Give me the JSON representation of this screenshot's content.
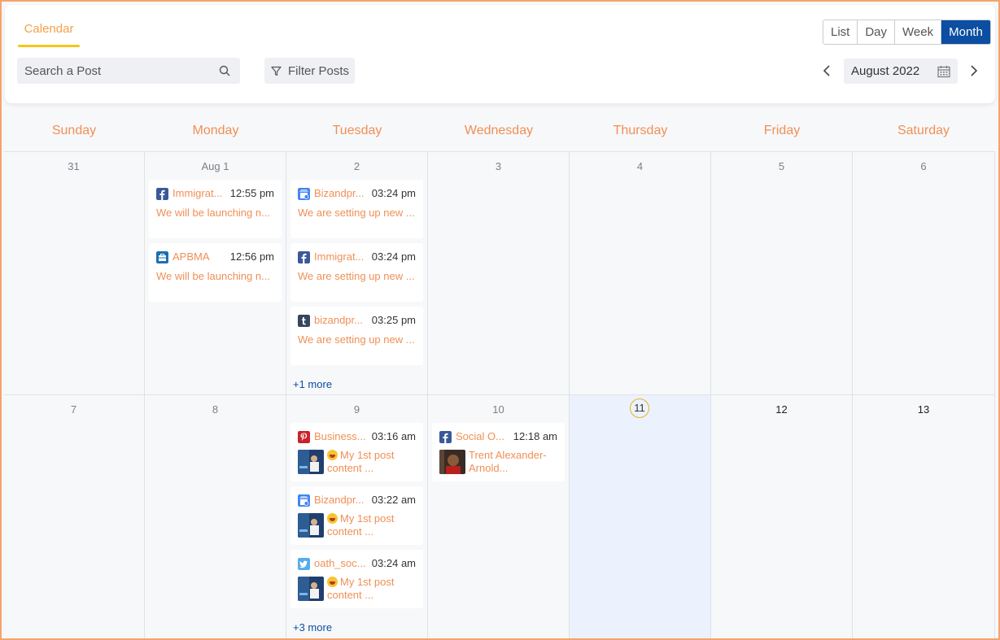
{
  "header": {
    "tab_label": "Calendar",
    "search_placeholder": "Search a Post",
    "filter_label": "Filter Posts",
    "views": [
      "List",
      "Day",
      "Week",
      "Month"
    ],
    "active_view": "Month",
    "month_label": "August 2022"
  },
  "weekdays": [
    "Sunday",
    "Monday",
    "Tuesday",
    "Wednesday",
    "Thursday",
    "Friday",
    "Saturday"
  ],
  "week1": {
    "days": [
      "31",
      "Aug 1",
      "2",
      "3",
      "4",
      "5",
      "6"
    ],
    "monday_posts": [
      {
        "account": "Immigrat...",
        "time": "12:55 pm",
        "text": "We will be launching n...",
        "network_icon": "facebook-icon"
      },
      {
        "account": "APBMA",
        "time": "12:56 pm",
        "text": "We will be launching n...",
        "network_icon": "google-business-icon"
      }
    ],
    "tuesday_posts": [
      {
        "account": "Bizandpr...",
        "time": "03:24 pm",
        "text": "We are setting up new ...",
        "network_icon": "google-my-business-icon"
      },
      {
        "account": "Immigrat...",
        "time": "03:24 pm",
        "text": "We are setting up new ...",
        "network_icon": "facebook-icon"
      },
      {
        "account": "bizandpr...",
        "time": "03:25 pm",
        "text": "We are setting up new ...",
        "network_icon": "tumblr-icon"
      }
    ],
    "tuesday_more": "+1 more"
  },
  "week2": {
    "days": [
      "7",
      "8",
      "9",
      "10",
      "11",
      "12",
      "13"
    ],
    "tuesday_posts": [
      {
        "account": "Business...",
        "time": "03:16 am",
        "line1": "My 1st post",
        "line2": "content ...",
        "network_icon": "pinterest-icon"
      },
      {
        "account": "Bizandpr...",
        "time": "03:22 am",
        "line1": "My 1st post",
        "line2": "content ...",
        "network_icon": "google-my-business-icon"
      },
      {
        "account": "oath_soc...",
        "time": "03:24 am",
        "line1": "My 1st post",
        "line2": "content ...",
        "network_icon": "twitter-icon"
      }
    ],
    "tuesday_more": "+3 more",
    "wednesday_posts": [
      {
        "account": "Social O...",
        "time": "12:18 am",
        "line1": "Trent Alexander-",
        "line2": "Arnold...",
        "network_icon": "facebook-icon"
      }
    ]
  },
  "colors": {
    "accent_orange": "#f08f56",
    "active_blue": "#0b4ea2",
    "today_bg": "#ebf2fd",
    "today_ring": "#e6b422"
  }
}
